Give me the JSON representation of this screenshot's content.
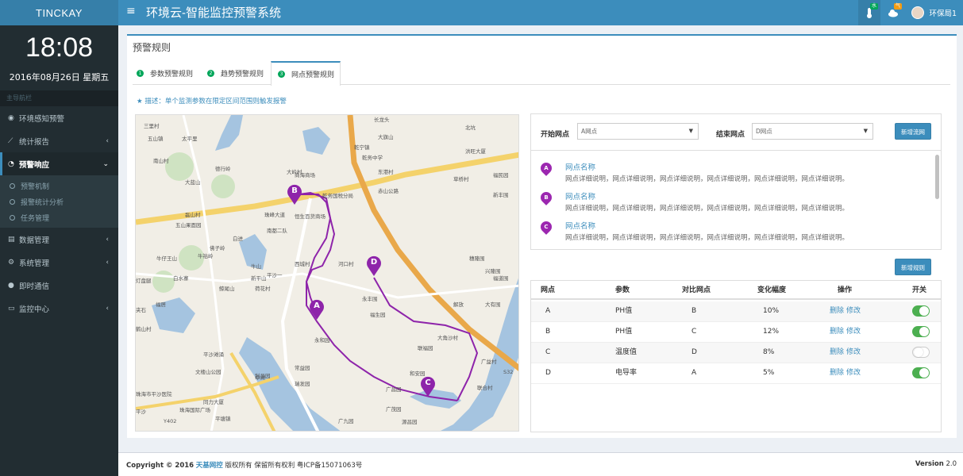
{
  "sidebar": {
    "brand": "TINCKAY",
    "clock": "18:08",
    "date": "2016年08月26日 星期五",
    "nav_header": "主导航栏",
    "items": [
      {
        "label": "环境感知预警",
        "icon": "circle-icon"
      },
      {
        "label": "统计报告",
        "icon": "line-chart-icon"
      },
      {
        "label": "预警响应",
        "icon": "dashboard-icon"
      },
      {
        "label": "数据管理",
        "icon": "database-icon"
      },
      {
        "label": "系统管理",
        "icon": "cogs-icon"
      },
      {
        "label": "即时通信",
        "icon": "comments-icon"
      },
      {
        "label": "监控中心",
        "icon": "desktop-icon"
      }
    ],
    "sub_items": [
      {
        "label": "预警机制"
      },
      {
        "label": "报警统计分析"
      },
      {
        "label": "任务管理"
      }
    ]
  },
  "header": {
    "title": "环境云-智能监控预警系统",
    "badge1": "水",
    "badge2": "气",
    "user": "环保局1"
  },
  "content": {
    "box_title": "预警规则",
    "tabs": [
      {
        "num": "1",
        "label": "参数预警规则"
      },
      {
        "num": "2",
        "label": "趋势预警规则"
      },
      {
        "num": "3",
        "label": "网点预警规则"
      }
    ],
    "description": "★ 描述：单个监测参数在限定区间范围则触发报警"
  },
  "map": {
    "labels": [
      "三里村",
      "五山镇",
      "太平里",
      "大岭村",
      "南山村",
      "德行岭",
      "大蓝山",
      "五山果面园",
      "磊山村",
      "佛子岭",
      "牛仔王山",
      "牛祜岭",
      "灯盘腿",
      "白水寨",
      "鲸尾山",
      "牛山",
      "新平山",
      "荷花村",
      "夹石",
      "鹤山村",
      "福居",
      "平沙滩涌",
      "文楼山公园",
      "卓湖",
      "珠海市平沙医院",
      "Y402",
      "同力大厦",
      "珠海国际广场",
      "平塘镇",
      "平沙",
      "利昌园",
      "常益园",
      "瑞发园",
      "永和园",
      "永丰围",
      "福生园",
      "联福园",
      "大角沙村",
      "广昌园",
      "广茂园",
      "源昌园",
      "和安园",
      "广九园",
      "解放",
      "大有围",
      "福道围",
      "兴隆围",
      "穗隆围",
      "草桥村",
      "福民园",
      "新丰围",
      "北坑",
      "大旗山",
      "乾宁镇",
      "乾务中学",
      "东港村",
      "洪旺大厦",
      "乾务国税分局",
      "恒生百货商场",
      "商海商场",
      "珠峰大道",
      "西城村",
      "河口村",
      "南都二队",
      "白进",
      "平沙一",
      "长龙头",
      "S32",
      "广益村",
      "联合村",
      "赤山公路"
    ],
    "markers": [
      {
        "label": "A"
      },
      {
        "label": "B"
      },
      {
        "label": "C"
      },
      {
        "label": "D"
      }
    ]
  },
  "route_panel": {
    "start_label": "开始网点",
    "start_value": "A网点",
    "end_label": "结束网点",
    "end_value": "D网点",
    "add_route_button": "新增流网",
    "points": [
      {
        "marker": "A",
        "name": "网点名称",
        "desc": "网点详细说明，网点详细说明，网点详细说明，网点详细说明，网点详细说明，网点详细说明。"
      },
      {
        "marker": "B",
        "name": "网点名称",
        "desc": "网点详细说明，网点详细说明，网点详细说明，网点详细说明，网点详细说明，网点详细说明。"
      },
      {
        "marker": "C",
        "name": "网点名称",
        "desc": "网点详细说明，网点详细说明，网点详细说明，网点详细说明，网点详细说明，网点详细说明。"
      }
    ]
  },
  "rules": {
    "add_rule_button": "新增规则",
    "columns": [
      "网点",
      "参数",
      "对比网点",
      "变化幅度",
      "操作",
      "开关"
    ],
    "delete_label": "删除",
    "edit_label": "修改",
    "rows": [
      {
        "point": "A",
        "param": "PH值",
        "compare": "B",
        "change": "10%",
        "enabled": true
      },
      {
        "point": "B",
        "param": "PH值",
        "compare": "C",
        "change": "12%",
        "enabled": true
      },
      {
        "point": "C",
        "param": "温度值",
        "compare": "D",
        "change": "8%",
        "enabled": false
      },
      {
        "point": "D",
        "param": "电导率",
        "compare": "A",
        "change": "5%",
        "enabled": true
      }
    ]
  },
  "footer": {
    "copyright": "Copyright © 2016",
    "company": "天基网控",
    "rights": "版权所有 保留所有权利 粤ICP备15071063号",
    "version_label": "Version",
    "version": "2.0"
  },
  "colors": {
    "brand": "#3c8dbc",
    "sidebar": "#222d32",
    "marker": "#9c27b0",
    "toggle_on": "#4caf50"
  }
}
